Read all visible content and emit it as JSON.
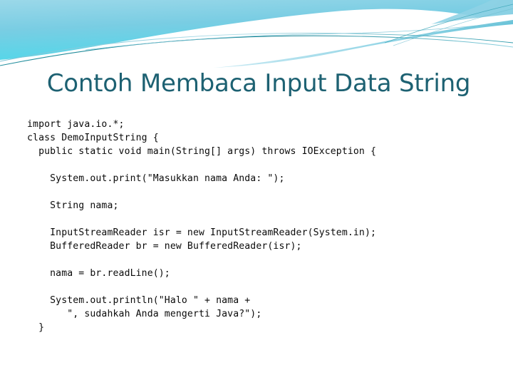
{
  "slide": {
    "title": "Contoh Membaca Input Data String",
    "title_color": "#1d6172",
    "background_color": "#ffffff",
    "decoration": {
      "name": "wave-banner",
      "colors": {
        "gradient_top": "#8fd4e8",
        "gradient_left": "#5fd9e8",
        "gradient_right": "#6ec6de",
        "wave_line_dark": "#1a8190",
        "wave_line_light": "#9fd9e6",
        "wave_fill_light": "#b8e4ef",
        "wave_fill_mid": "#63c4da"
      }
    },
    "code": {
      "language": "java",
      "lines": [
        "import java.io.*;",
        "class DemoInputString {",
        "  public static void main(String[] args) throws IOException {",
        "",
        "    System.out.print(\"Masukkan nama Anda: \");",
        "",
        "    String nama;",
        "",
        "    InputStreamReader isr = new InputStreamReader(System.in);",
        "    BufferedReader br = new BufferedReader(isr);",
        "",
        "    nama = br.readLine();",
        "",
        "    System.out.println(\"Halo \" + nama +",
        "       \", sudahkah Anda mengerti Java?\");",
        "  }"
      ]
    }
  }
}
